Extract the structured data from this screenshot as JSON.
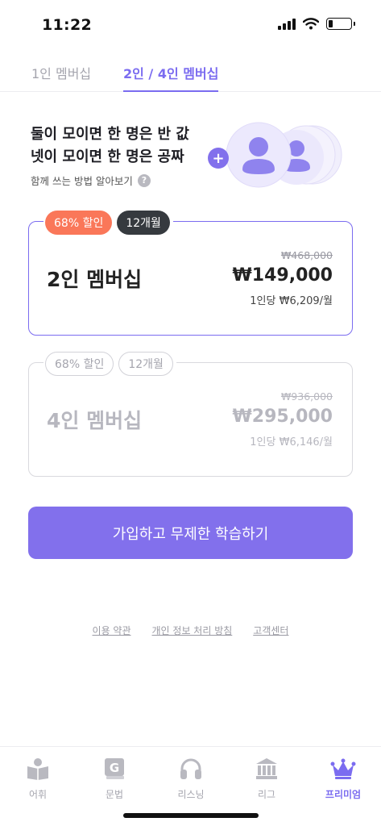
{
  "status": {
    "time": "11:22",
    "battery_level": 0.2
  },
  "tabs": [
    {
      "label": "1인 멤버십",
      "active": false
    },
    {
      "label": "2인 / 4인 멤버십",
      "active": true
    }
  ],
  "promo": {
    "line1": "둘이 모이면 한 명은 반 값",
    "line2": "넷이 모이면 한 명은 공짜",
    "howto": "함께 쓰는 방법 알아보기",
    "help_glyph": "?",
    "plus_glyph": "+"
  },
  "plans": [
    {
      "discount": "68% 할인",
      "months": "12개월",
      "name": "2인 멤버십",
      "original_price": "₩468,000",
      "price": "₩149,000",
      "per_person": "1인당 ₩6,209/월",
      "selected": true
    },
    {
      "discount": "68% 할인",
      "months": "12개월",
      "name": "4인 멤버십",
      "original_price": "₩936,000",
      "price": "₩295,000",
      "per_person": "1인당 ₩6,146/월",
      "selected": false
    }
  ],
  "cta": {
    "label": "가입하고 무제한 학습하기"
  },
  "footer_links": [
    "이용 약관",
    "개인 정보 처리 방침",
    "고객센터"
  ],
  "bottom_nav": [
    {
      "label": "어휘",
      "icon": "book-icon",
      "active": false
    },
    {
      "label": "문법",
      "icon": "grammar-g-icon",
      "active": false
    },
    {
      "label": "리스닝",
      "icon": "headphones-icon",
      "active": false
    },
    {
      "label": "리그",
      "icon": "building-icon",
      "active": false
    },
    {
      "label": "프리미엄",
      "icon": "crown-icon",
      "active": true
    }
  ],
  "colors": {
    "accent": "#7b6cf0",
    "cta": "#8270ec",
    "discount_badge": "#fa7759",
    "months_badge": "#363a3f"
  }
}
